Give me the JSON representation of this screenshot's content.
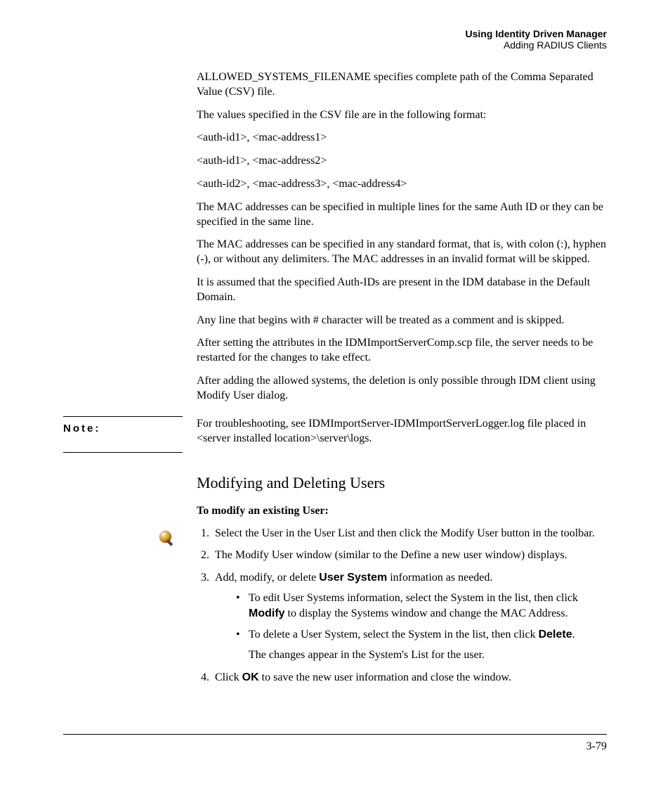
{
  "header": {
    "title": "Using Identity Driven Manager",
    "subtitle": "Adding RADIUS Clients"
  },
  "paragraphs": {
    "p1": "ALLOWED_SYSTEMS_FILENAME specifies complete path of the Comma Separated Value (CSV) file.",
    "p2": "The values specified in the CSV file are in the following format:",
    "p3": "<auth-id1>, <mac-address1>",
    "p4": "<auth-id1>, <mac-address2>",
    "p5": "<auth-id2>, <mac-address3>, <mac-address4>",
    "p6": "The MAC addresses can be specified in multiple lines for the same Auth ID or they can be specified in the same line.",
    "p7": "The MAC addresses can be specified in any standard format, that is, with colon (:), hyphen (-), or without any delimiters. The MAC addresses in an invalid format will be skipped.",
    "p8": "It is assumed that the specified Auth-IDs are present in the IDM database in the Default Domain.",
    "p9": "Any line that begins with # character will be treated as a comment and is skipped.",
    "p10": "After setting the attributes in the IDMImportServerComp.scp file, the server needs to be restarted for the changes to take effect.",
    "p11": "After adding the allowed systems, the deletion is only possible through IDM client using Modify User dialog."
  },
  "note": {
    "label": "Note:",
    "text": "For troubleshooting, see IDMImportServer-IDMImportServerLogger.log file placed in <server installed location>\\server\\logs."
  },
  "section": {
    "heading": "Modifying and Deleting Users",
    "subheading": "To modify an existing User:"
  },
  "steps": {
    "s1": "Select the User in the User List and then click the Modify User button in the toolbar.",
    "s2": "The Modify User window (similar to the Define a new user window) displays.",
    "s3_pre": "Add, modify, or delete ",
    "s3_bold": "User System",
    "s3_post": " information as needed.",
    "s3_b1_pre": "To edit User Systems information, select the System in the list, then click ",
    "s3_b1_bold": "Modify",
    "s3_b1_post": " to display the Systems window and change the MAC Address.",
    "s3_b2_pre": "To delete a User System, select the System in the list, then click ",
    "s3_b2_bold": "Delete",
    "s3_b2_post": ".",
    "s3_b2_line2": "The changes appear in the System's List for the user.",
    "s4_pre": "Click ",
    "s4_bold": "OK",
    "s4_post": " to save the new user information and close the window."
  },
  "footer": {
    "pagenum": "3-79"
  }
}
